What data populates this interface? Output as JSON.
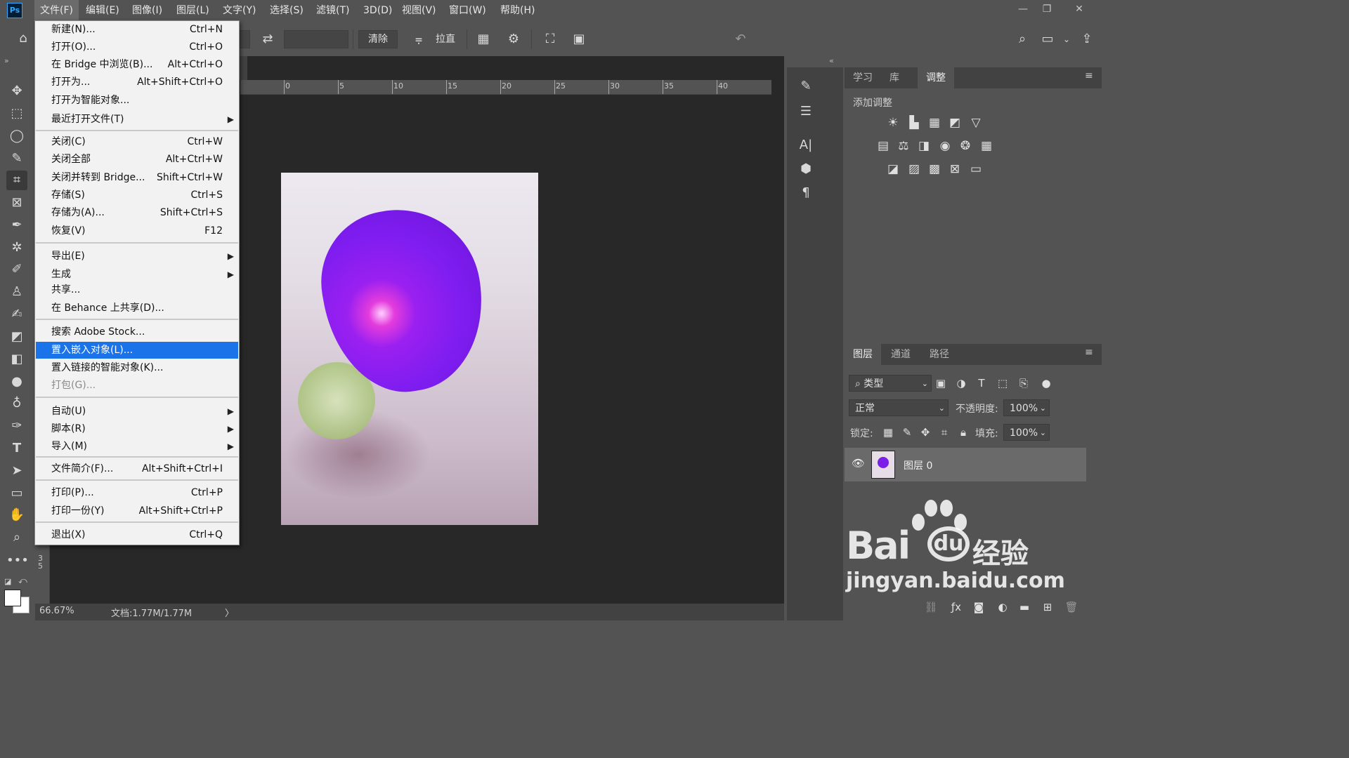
{
  "app": {
    "logo": "Ps"
  },
  "menubar": [
    {
      "label": "文件(F)",
      "active": true
    },
    {
      "label": "编辑(E)"
    },
    {
      "label": "图像(I)"
    },
    {
      "label": "图层(L)"
    },
    {
      "label": "文字(Y)"
    },
    {
      "label": "选择(S)"
    },
    {
      "label": "滤镜(T)"
    },
    {
      "label": "3D(D)"
    },
    {
      "label": "视图(V)"
    },
    {
      "label": "窗口(W)"
    },
    {
      "label": "帮助(H)"
    }
  ],
  "window_controls": {
    "minimize": "—",
    "restore": "❐",
    "close": "✕"
  },
  "options": {
    "clear_label": "清除",
    "straighten_label": "拉直"
  },
  "file_menu": {
    "items": [
      {
        "label": "新建(N)...",
        "shortcut": "Ctrl+N"
      },
      {
        "label": "打开(O)...",
        "shortcut": "Ctrl+O"
      },
      {
        "label": "在 Bridge 中浏览(B)...",
        "shortcut": "Alt+Ctrl+O"
      },
      {
        "label": "打开为...",
        "shortcut": "Alt+Shift+Ctrl+O"
      },
      {
        "label": "打开为智能对象..."
      },
      {
        "label": "最近打开文件(T)",
        "submenu": true
      },
      {
        "label": "关闭(C)",
        "shortcut": "Ctrl+W"
      },
      {
        "label": "关闭全部",
        "shortcut": "Alt+Ctrl+W"
      },
      {
        "label": "关闭并转到 Bridge...",
        "shortcut": "Shift+Ctrl+W"
      },
      {
        "label": "存储(S)",
        "shortcut": "Ctrl+S"
      },
      {
        "label": "存储为(A)...",
        "shortcut": "Shift+Ctrl+S"
      },
      {
        "label": "恢复(V)",
        "shortcut": "F12"
      },
      {
        "label": "导出(E)",
        "submenu": true
      },
      {
        "label": "生成",
        "submenu": true
      },
      {
        "label": "共享..."
      },
      {
        "label": "在 Behance 上共享(D)..."
      },
      {
        "label": "搜索 Adobe Stock..."
      },
      {
        "label": "置入嵌入对象(L)...",
        "highlighted": true
      },
      {
        "label": "置入链接的智能对象(K)..."
      },
      {
        "label": "打包(G)...",
        "disabled": true
      },
      {
        "label": "自动(U)",
        "submenu": true
      },
      {
        "label": "脚本(R)",
        "submenu": true
      },
      {
        "label": "导入(M)",
        "submenu": true
      },
      {
        "label": "文件简介(F)...",
        "shortcut": "Alt+Shift+Ctrl+I"
      },
      {
        "label": "打印(P)...",
        "shortcut": "Ctrl+P"
      },
      {
        "label": "打印一份(Y)",
        "shortcut": "Alt+Shift+Ctrl+P"
      },
      {
        "label": "退出(X)",
        "shortcut": "Ctrl+Q"
      }
    ]
  },
  "ruler": {
    "labels": [
      "0",
      "5",
      "10",
      "15",
      "20",
      "25",
      "30",
      "35",
      "40"
    ],
    "vertical_label": "35"
  },
  "status": {
    "zoom": "66.67%",
    "doc": "文档:1.77M/1.77M",
    "arrow": "〉"
  },
  "adjust_panel": {
    "tabs": [
      {
        "label": "学习"
      },
      {
        "label": "库"
      },
      {
        "label": "调整",
        "active": true
      }
    ],
    "heading": "添加调整"
  },
  "layers_panel": {
    "tabs": [
      {
        "label": "图层",
        "active": true
      },
      {
        "label": "通道"
      },
      {
        "label": "路径"
      }
    ],
    "filter_label": "类型",
    "blend_mode": "正常",
    "opacity_label": "不透明度:",
    "opacity_value": "100%",
    "lock_label": "锁定:",
    "fill_label": "填充:",
    "fill_value": "100%",
    "layers": [
      {
        "name": "图层 0"
      }
    ]
  },
  "watermark": {
    "brand": "Bai",
    "brand_suffix": "经验",
    "url": "jingyan.baidu.com"
  }
}
